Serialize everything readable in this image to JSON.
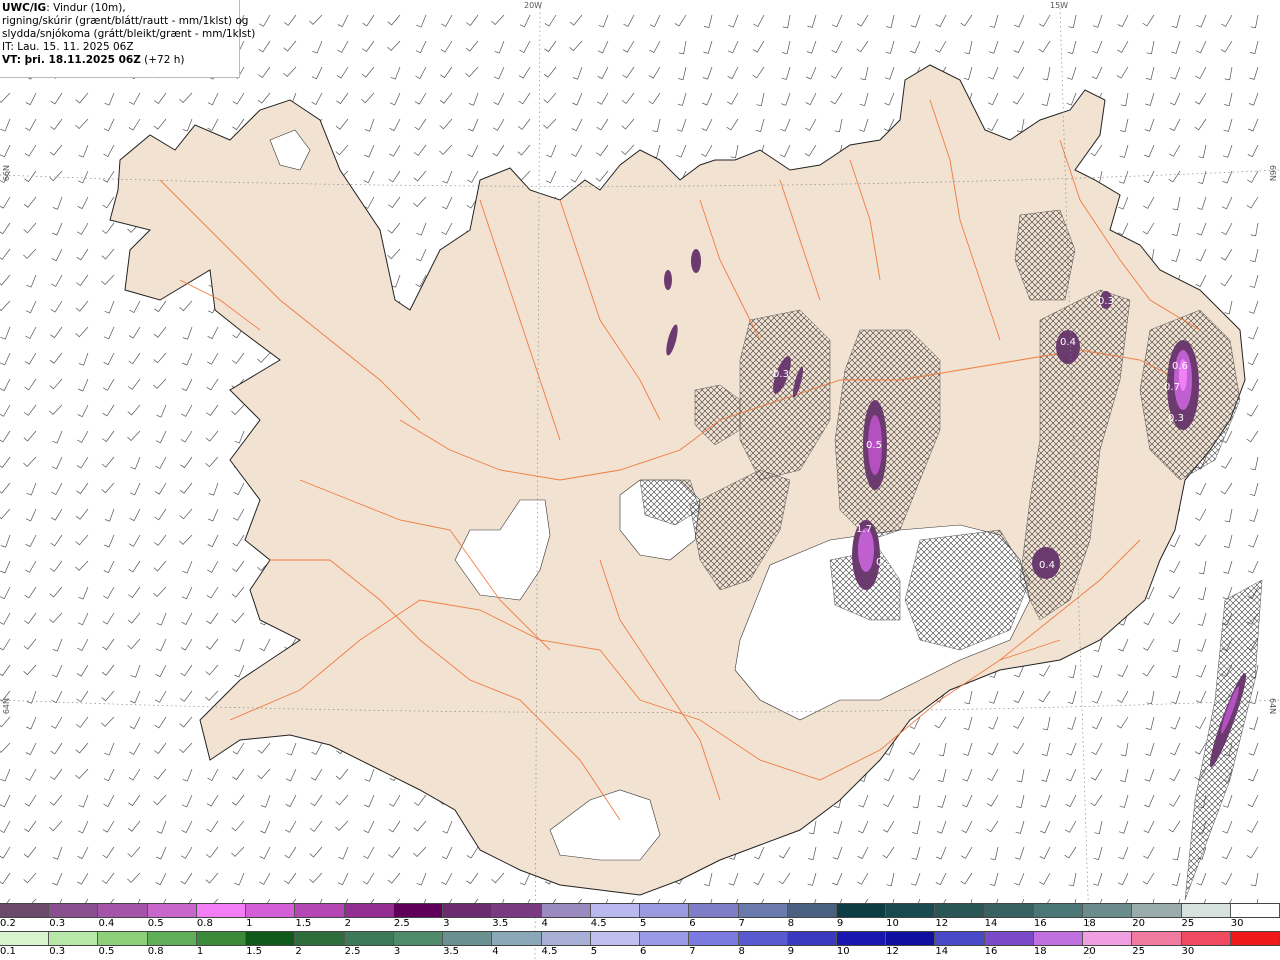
{
  "header": {
    "line1_bold": "UWC/IG",
    "line1_rest": ": Vindur (10m),",
    "line2": "rigning/skúrir (grænt/blátt/rautt - mm/1klst) og",
    "line3": "slydda/snjókoma (grátt/bleikt/grænt - mm/1klst)",
    "line4": "IT: Lau. 15. 11. 2025 06Z",
    "line5_bold": "VT: þri. 18.11.2025 06Z",
    "line5_rest": " (+72 h)"
  },
  "graticule": {
    "lon_top_1": "20W",
    "lon_top_2": "15W",
    "lat_left_1": "66N",
    "lat_left_2": "64N",
    "lat_right_1": "66N",
    "lat_right_2": "64N"
  },
  "precip_labels": {
    "l1": "0.5",
    "l2": "0.4",
    "l3": "0.6",
    "l4": "0.7",
    "l5": "0.3",
    "l6": "0.3",
    "l7": "0.4",
    "l8": "0.3",
    "l9": "1.7",
    "l10": "0.3"
  },
  "colorbar_top": {
    "colors": [
      "#6b4a6b",
      "#8a4f8f",
      "#a455a9",
      "#c767cc",
      "#f37df5",
      "#d25fd6",
      "#b447b4",
      "#942e93",
      "#5e005a",
      "#6d2b6f",
      "#7a3a82",
      "#9a8ac0",
      "#b9b9f0",
      "#9a9ae0",
      "#7e7ec8",
      "#6a7aac",
      "#4a6080",
      "#0c3c44",
      "#194a50",
      "#2a5656",
      "#386262",
      "#4a7676",
      "#6a8c8c",
      "#9aacac",
      "#d6e2de",
      "#ffffff"
    ],
    "labels": [
      "0.2",
      "0.3",
      "0.4",
      "0.5",
      "0.8",
      "1",
      "1.5",
      "2",
      "2.5",
      "3",
      "3.5",
      "4",
      "4.5",
      "5",
      "6",
      "7",
      "8",
      "9",
      "10",
      "12",
      "14",
      "16",
      "18",
      "20",
      "25",
      "30"
    ]
  },
  "colorbar_bottom": {
    "colors": [
      "#d8f5d0",
      "#b8e8a8",
      "#8ed07a",
      "#5fae58",
      "#3a8a3a",
      "#0f5a18",
      "#2f6e3c",
      "#3f7a58",
      "#4f8a6a",
      "#6a9090",
      "#8aa8b8",
      "#a8b0d8",
      "#c0c0f0",
      "#9a9ae8",
      "#7a7ae0",
      "#5a5ad0",
      "#3a3ac0",
      "#1818b0",
      "#1010a0",
      "#4848c8",
      "#7a4ac8",
      "#c070e0",
      "#f0a0e0",
      "#f07aa0",
      "#f04a60",
      "#f01818"
    ],
    "labels": [
      "0.1",
      "0.3",
      "0.5",
      "0.8",
      "1",
      "1.5",
      "2",
      "2.5",
      "3",
      "3.5",
      "4",
      "4.5",
      "5",
      "6",
      "7",
      "8",
      "9",
      "10",
      "12",
      "14",
      "16",
      "18",
      "20",
      "25",
      "30"
    ]
  },
  "colors": {
    "land": "#f2e2d2",
    "coast": "#222222",
    "roads": "#f07030",
    "glacier": "#ffffff",
    "hatch": "#444444",
    "barbs": "#555555"
  }
}
